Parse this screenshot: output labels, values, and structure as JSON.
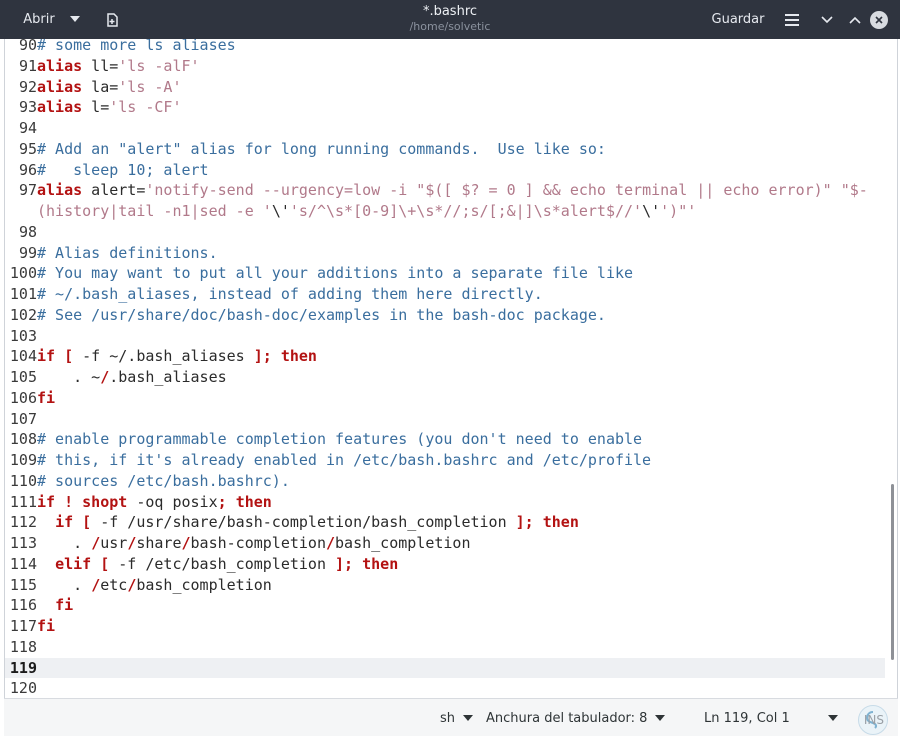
{
  "titlebar": {
    "open_label": "Abrir",
    "title": "*.bashrc",
    "subtitle": "/home/solvetic",
    "save_label": "Guardar"
  },
  "editor": {
    "current_line": 119,
    "lines": [
      {
        "n": "90",
        "parts": [
          {
            "t": "c",
            "v": "# some more ls aliases"
          }
        ]
      },
      {
        "n": "91",
        "parts": [
          {
            "t": "k",
            "v": "alias"
          },
          {
            "t": "p",
            "v": " ll="
          },
          {
            "t": "s",
            "v": "'ls -alF'"
          }
        ]
      },
      {
        "n": "92",
        "parts": [
          {
            "t": "k",
            "v": "alias"
          },
          {
            "t": "p",
            "v": " la="
          },
          {
            "t": "s",
            "v": "'ls -A'"
          }
        ]
      },
      {
        "n": "93",
        "parts": [
          {
            "t": "k",
            "v": "alias"
          },
          {
            "t": "p",
            "v": " l="
          },
          {
            "t": "s",
            "v": "'ls -CF'"
          }
        ]
      },
      {
        "n": "94",
        "parts": []
      },
      {
        "n": "95",
        "parts": [
          {
            "t": "c",
            "v": "# Add an \"alert\" alias for long running commands.  Use like so:"
          }
        ]
      },
      {
        "n": "96",
        "parts": [
          {
            "t": "c",
            "v": "#   sleep 10; alert"
          }
        ]
      },
      {
        "n": "97",
        "parts": [
          {
            "t": "k",
            "v": "alias"
          },
          {
            "t": "p",
            "v": " alert="
          },
          {
            "t": "s",
            "v": "'notify-send --urgency=low -i \"$([ $? = 0 ] && echo terminal || echo error)\" \"$-"
          }
        ]
      },
      {
        "n": "",
        "parts": [
          {
            "t": "s",
            "v": "(history|tail -n1|sed -e '"
          },
          {
            "t": "p",
            "v": "\\'"
          },
          {
            "t": "s",
            "v": "'s/^\\s*[0-9]\\+\\s*//;s/[;&|]\\s*alert$//'"
          },
          {
            "t": "p",
            "v": "\\'"
          },
          {
            "t": "s",
            "v": "')\"'"
          }
        ]
      },
      {
        "n": "98",
        "parts": []
      },
      {
        "n": "99",
        "parts": [
          {
            "t": "c",
            "v": "# Alias definitions."
          }
        ]
      },
      {
        "n": "100",
        "parts": [
          {
            "t": "c",
            "v": "# You may want to put all your additions into a separate file like"
          }
        ]
      },
      {
        "n": "101",
        "parts": [
          {
            "t": "c",
            "v": "# ~/.bash_aliases, instead of adding them here directly."
          }
        ]
      },
      {
        "n": "102",
        "parts": [
          {
            "t": "c",
            "v": "# See /usr/share/doc/bash-doc/examples in the bash-doc package."
          }
        ]
      },
      {
        "n": "103",
        "parts": []
      },
      {
        "n": "104",
        "parts": [
          {
            "t": "k",
            "v": "if"
          },
          {
            "t": "p",
            "v": " "
          },
          {
            "t": "k",
            "v": "["
          },
          {
            "t": "p",
            "v": " -f ~/.bash_aliases "
          },
          {
            "t": "k",
            "v": "];"
          },
          {
            "t": "p",
            "v": " "
          },
          {
            "t": "k",
            "v": "then"
          }
        ]
      },
      {
        "n": "105",
        "parts": [
          {
            "t": "p",
            "v": "    . ~"
          },
          {
            "t": "k",
            "v": "/"
          },
          {
            "t": "p",
            "v": ".bash_aliases"
          }
        ]
      },
      {
        "n": "106",
        "parts": [
          {
            "t": "k",
            "v": "fi"
          }
        ]
      },
      {
        "n": "107",
        "parts": []
      },
      {
        "n": "108",
        "parts": [
          {
            "t": "c",
            "v": "# enable programmable completion features (you don't need to enable"
          }
        ]
      },
      {
        "n": "109",
        "parts": [
          {
            "t": "c",
            "v": "# this, if it's already enabled in /etc/bash.bashrc and /etc/profile"
          }
        ]
      },
      {
        "n": "110",
        "parts": [
          {
            "t": "c",
            "v": "# sources /etc/bash.bashrc)."
          }
        ]
      },
      {
        "n": "111",
        "parts": [
          {
            "t": "k",
            "v": "if"
          },
          {
            "t": "p",
            "v": " "
          },
          {
            "t": "k",
            "v": "!"
          },
          {
            "t": "p",
            "v": " "
          },
          {
            "t": "k",
            "v": "shopt"
          },
          {
            "t": "p",
            "v": " -oq posix"
          },
          {
            "t": "k",
            "v": ";"
          },
          {
            "t": "p",
            "v": " "
          },
          {
            "t": "k",
            "v": "then"
          }
        ]
      },
      {
        "n": "112",
        "parts": [
          {
            "t": "p",
            "v": "  "
          },
          {
            "t": "k",
            "v": "if"
          },
          {
            "t": "p",
            "v": " "
          },
          {
            "t": "k",
            "v": "["
          },
          {
            "t": "p",
            "v": " -f /usr/share/bash-completion/bash_completion "
          },
          {
            "t": "k",
            "v": "];"
          },
          {
            "t": "p",
            "v": " "
          },
          {
            "t": "k",
            "v": "then"
          }
        ]
      },
      {
        "n": "113",
        "parts": [
          {
            "t": "p",
            "v": "    . "
          },
          {
            "t": "k",
            "v": "/"
          },
          {
            "t": "p",
            "v": "usr"
          },
          {
            "t": "k",
            "v": "/"
          },
          {
            "t": "p",
            "v": "share"
          },
          {
            "t": "k",
            "v": "/"
          },
          {
            "t": "p",
            "v": "bash-completion"
          },
          {
            "t": "k",
            "v": "/"
          },
          {
            "t": "p",
            "v": "bash_completion"
          }
        ]
      },
      {
        "n": "114",
        "parts": [
          {
            "t": "p",
            "v": "  "
          },
          {
            "t": "k",
            "v": "elif"
          },
          {
            "t": "p",
            "v": " "
          },
          {
            "t": "k",
            "v": "["
          },
          {
            "t": "p",
            "v": " -f /etc/bash_completion "
          },
          {
            "t": "k",
            "v": "];"
          },
          {
            "t": "p",
            "v": " "
          },
          {
            "t": "k",
            "v": "then"
          }
        ]
      },
      {
        "n": "115",
        "parts": [
          {
            "t": "p",
            "v": "    . "
          },
          {
            "t": "k",
            "v": "/"
          },
          {
            "t": "p",
            "v": "etc"
          },
          {
            "t": "k",
            "v": "/"
          },
          {
            "t": "p",
            "v": "bash_completion"
          }
        ]
      },
      {
        "n": "116",
        "parts": [
          {
            "t": "p",
            "v": "  "
          },
          {
            "t": "k",
            "v": "fi"
          }
        ]
      },
      {
        "n": "117",
        "parts": [
          {
            "t": "k",
            "v": "fi"
          }
        ]
      },
      {
        "n": "118",
        "parts": []
      },
      {
        "n": "119",
        "parts": []
      },
      {
        "n": "120",
        "parts": []
      }
    ]
  },
  "statusbar": {
    "language": "sh",
    "tab_width": "Anchura del tabulador: 8",
    "position": "Ln 119, Col 1",
    "insert_mode": "INS"
  },
  "colors": {
    "titlebar_bg": "#2f343f",
    "comment": "#3a6e9e",
    "keyword": "#b31212",
    "string": "#b1798a",
    "current_line_bg": "#eef0f3"
  }
}
